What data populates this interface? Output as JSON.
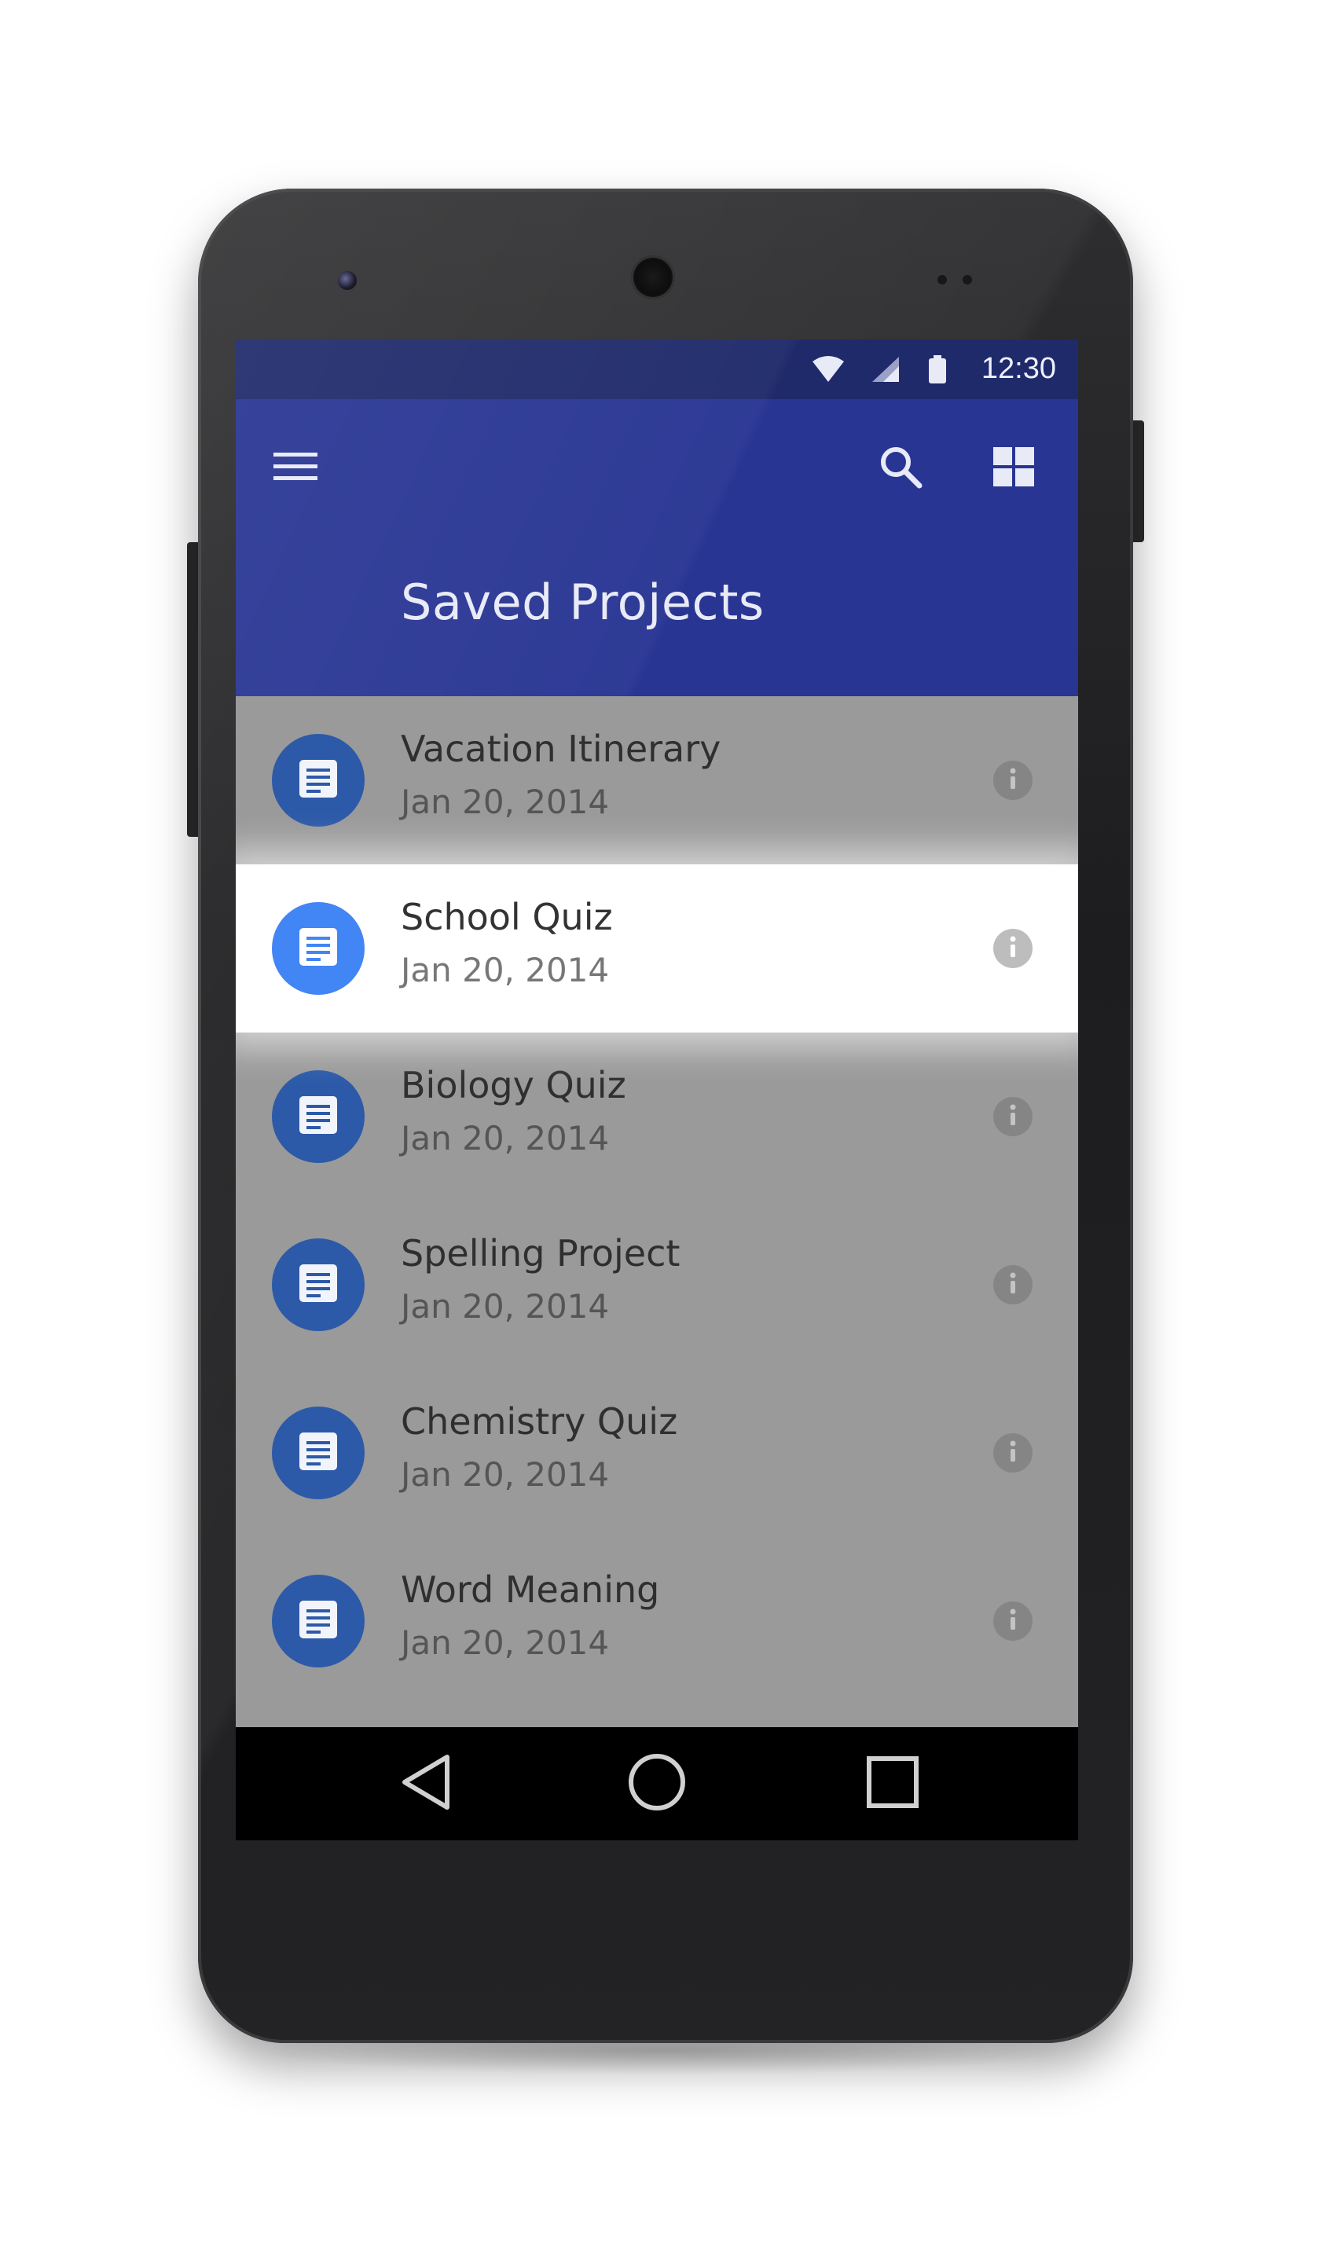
{
  "status_bar": {
    "time": "12:30",
    "icons": [
      "wifi-icon",
      "signal-icon",
      "battery-icon"
    ]
  },
  "app_bar": {
    "title": "Saved Projects",
    "menu_icon": "menu-icon",
    "search_icon": "search-icon",
    "grid_icon": "grid-view-icon",
    "color": "#283593"
  },
  "list": {
    "items": [
      {
        "title": "Vacation Itinerary",
        "date": "Jan 20, 2014",
        "icon": "document-icon",
        "selected": false
      },
      {
        "title": "School Quiz",
        "date": "Jan 20, 2014",
        "icon": "document-icon",
        "selected": true
      },
      {
        "title": "Biology Quiz",
        "date": "Jan 20, 2014",
        "icon": "document-icon",
        "selected": false
      },
      {
        "title": "Spelling Project",
        "date": "Jan 20, 2014",
        "icon": "document-icon",
        "selected": false
      },
      {
        "title": "Chemistry Quiz",
        "date": "Jan 20, 2014",
        "icon": "document-icon",
        "selected": false
      },
      {
        "title": "Word Meaning",
        "date": "Jan 20, 2014",
        "icon": "document-icon",
        "selected": false
      }
    ],
    "accent_color": "#4285f4"
  },
  "nav_bar": {
    "icons": [
      "back-icon",
      "home-icon",
      "recents-icon"
    ]
  }
}
